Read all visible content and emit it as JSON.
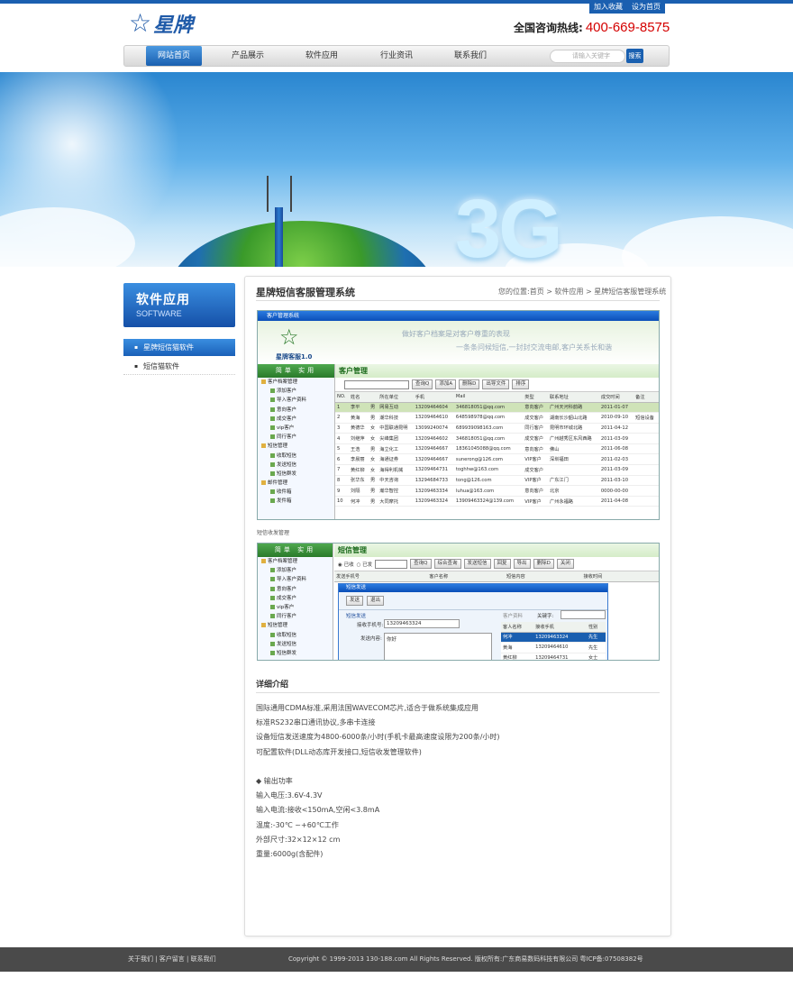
{
  "header": {
    "toplinks": [
      "加入收藏",
      "设为首页"
    ],
    "logo_text": "星牌",
    "hotline_label": "全国咨询热线:",
    "hotline_number": "400-669-8575"
  },
  "nav": {
    "items": [
      "网站首页",
      "产品展示",
      "软件应用",
      "行业资讯",
      "联系我们"
    ],
    "active_index": 0,
    "search_placeholder": "请输入关键字",
    "search_button": "搜索"
  },
  "banner": {
    "text": "3G"
  },
  "sidebar": {
    "title_cn": "软件应用",
    "title_en": "SOFTWARE",
    "items": [
      "星牌短信猫软件",
      "短信猫软件"
    ],
    "active_index": 0
  },
  "main": {
    "title": "星牌短信客服管理系统",
    "breadcrumb": "您的位置:首页 > 软件应用 > 星牌短信客服管理系统"
  },
  "screenshot1": {
    "window_title": "客户管理系统",
    "app_name": "星牌客服1.0",
    "slogan1": "做好客户档案是对客户尊重的表现",
    "slogan2": "一条条问候短信,一封封交流电邮,客户关系长和谐",
    "tree_header": "简单 实用",
    "tree": [
      "客户档案管理",
      "添加客户",
      "导入客户资料",
      "意向客户",
      "成交客户",
      "vip客户",
      "同行客户",
      "短信管理",
      "收取短信",
      "发送短信",
      "短信群发",
      "邮件管理",
      "收件箱",
      "发件箱"
    ],
    "panel_title": "客户管理",
    "toolbar_buttons": [
      "查询Q",
      "添加A",
      "删除D",
      "出导文件",
      "排序"
    ],
    "columns": [
      "NO.",
      "姓名",
      "",
      "所在单位",
      "手机",
      "Mail",
      "类型",
      "联系地址",
      "成交时间",
      "备注"
    ],
    "rows": [
      [
        "1",
        "李平",
        "男",
        "网易互动",
        "13209464604",
        "346818051@qq.com",
        "意向客户",
        "广州天河科韵路",
        "2011-01-07",
        ""
      ],
      [
        "2",
        "黄海",
        "男",
        "潮华科技",
        "13209464610",
        "648598978@qq.com",
        "成交客户",
        "湖南长沙韶山北路",
        "2010-09-10",
        "短信设备"
      ],
      [
        "3",
        "黄德华",
        "女",
        "中国联通昆明",
        "13099240074",
        "689939098163.com",
        "同行客户",
        "昆明市环城北路",
        "2011-04-12",
        ""
      ],
      [
        "4",
        "刘继萍",
        "女",
        "尖峰集团",
        "13209464602",
        "346818051@qq.com",
        "成交客户",
        "广州越秀区东风西路",
        "2011-03-09",
        ""
      ],
      [
        "5",
        "王浩",
        "男",
        "海立化工",
        "13209464667",
        "18361045088@qq.com",
        "意向客户",
        "佛山",
        "2011-06-08",
        ""
      ],
      [
        "6",
        "李晨丽",
        "女",
        "海通证券",
        "13209464667",
        "sunerong@126.com",
        "VIP客户",
        "深圳福田",
        "2011-02-03",
        ""
      ],
      [
        "7",
        "黄红柳",
        "女",
        "海得利机械",
        "13209464731",
        "toghhw@163.com",
        "成交客户",
        "",
        "2011-03-09",
        ""
      ],
      [
        "8",
        "张华东",
        "男",
        "中天咨询",
        "13294684733",
        "tong@126.com",
        "VIP客户",
        "广东江门",
        "2011-03-10",
        ""
      ],
      [
        "9",
        "刘隔",
        "男",
        "瀚华智控",
        "13209463334",
        "luhua@163.com",
        "意向客户",
        "北京",
        "0000-00-00",
        ""
      ],
      [
        "10",
        "何冲",
        "男",
        "大同摩托",
        "13209463324",
        "13909463324@139.com",
        "VIP客户",
        "广州永福路",
        "2011-04-08",
        ""
      ]
    ],
    "selected_row": 0
  },
  "screenshot2": {
    "caption": "短信收发管理",
    "tree_header": "简单 实用",
    "tree": [
      "客户档案管理",
      "添加客户",
      "导入客户资料",
      "意向客户",
      "成交客户",
      "vip客户",
      "同行客户",
      "短信管理",
      "收取短信",
      "发送短信",
      "短信群发"
    ],
    "panel_title": "短信管理",
    "radio_labels": [
      "已收",
      "已发"
    ],
    "toolbar_buttons": [
      "查询Q",
      "综合查询",
      "发送短信",
      "回复",
      "导出",
      "删除D",
      "关闭"
    ],
    "columns": [
      "发送手机号",
      "客户名称",
      "短信内容",
      "接收时间"
    ],
    "dialog_title": "短信发送",
    "dialog_buttons": [
      "发送",
      "退出"
    ],
    "group_label": "短信发送",
    "phone_label": "接收手机号:",
    "phone_value": "13209463324",
    "content_label": "发送内容:",
    "content_value": "你好",
    "customer_label": "客户资料",
    "keyword_label": "关键字:",
    "customer_columns": [
      "客人名称",
      "接收手机",
      "性别"
    ],
    "customers": [
      [
        "何冲",
        "13209463324",
        "先生"
      ],
      [
        "黄海",
        "13209464610",
        "先生"
      ],
      [
        "黄红柳",
        "13209464731",
        "女士"
      ]
    ]
  },
  "details": {
    "title": "详细介绍",
    "lines": [
      "国际通用CDMA标准,采用法国WAVECOM芯片,适合于做系统集成应用",
      "标准RS232串口通讯协议,多串卡连接",
      "设备短信发送速度为4800-6000条/小时(手机卡最高速度设限为200条/小时)",
      "可配置软件(DLL动态库开发接口,短信收发管理软件)",
      "",
      "◆ 输出功率",
      "输入电压:3.6V-4.3V",
      "输入电流:接收<150mA,空闲<3.8mA",
      "温度:-30℃ ~+60℃工作",
      "外部尺寸:32×12×12 cm",
      "重量:6000g(含配件)"
    ]
  },
  "footer": {
    "links": "关于我们 | 客户留言 | 联系我们",
    "copyright": "Copyright © 1999-2013 130-188.com All Rights Reserved.  版权所有:广东商易数码科技有限公司      粤ICP备:07508382号"
  },
  "colors": {
    "brand_blue": "#1a5fb0",
    "hotline_red": "#d40000",
    "footer_bg": "#4a4a4a",
    "app_green": "#2a7a2a"
  }
}
